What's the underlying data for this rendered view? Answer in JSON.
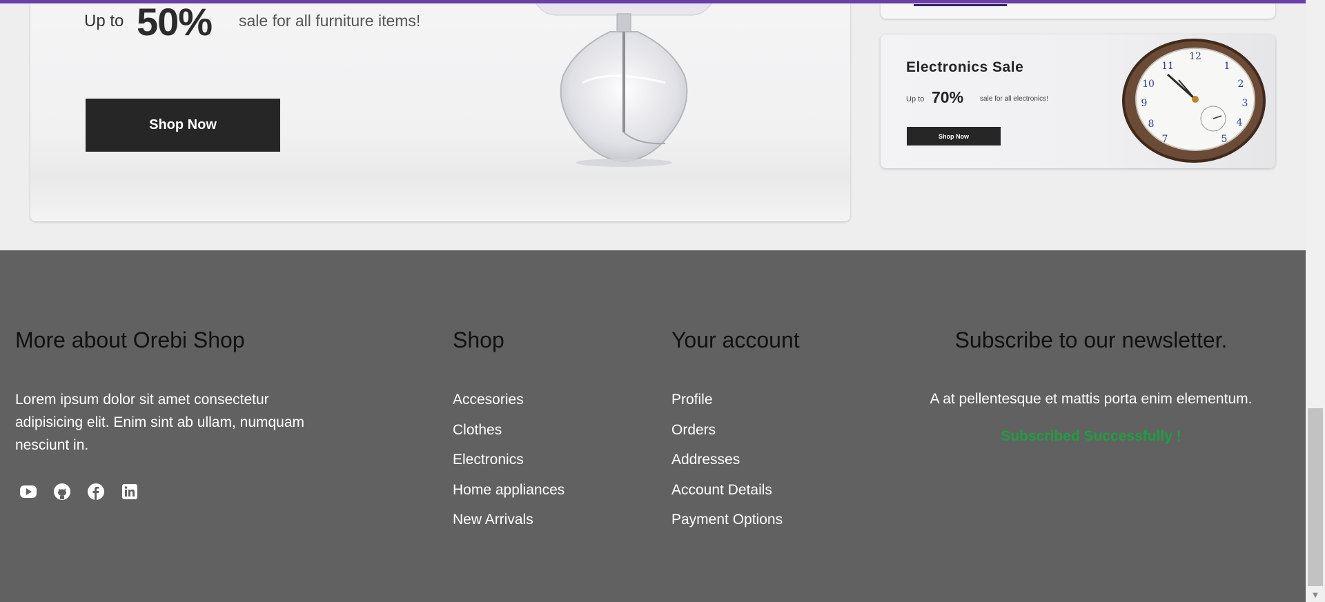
{
  "hero": {
    "up_to": "Up to",
    "percent": "50%",
    "subtitle": "sale for all furniture items!",
    "button": "Shop Now"
  },
  "side_card": {
    "title": "Electronics Sale",
    "up_to": "Up to",
    "percent": "70%",
    "subtitle": "sale for all electronics!",
    "button": "Shop Now"
  },
  "footer": {
    "about": {
      "heading": "More about Orebi Shop",
      "text_lines": [
        "Lorem ipsum dolor sit amet consectetur",
        "adipisicing elit. Enim sint ab ullam, numquam",
        "nesciunt in."
      ],
      "social_icons": [
        "youtube-icon",
        "github-icon",
        "facebook-icon",
        "linkedin-icon"
      ]
    },
    "shop": {
      "heading": "Shop",
      "links": [
        "Accesories",
        "Clothes",
        "Electronics",
        "Home appliances",
        "New Arrivals"
      ]
    },
    "account": {
      "heading": "Your account",
      "links": [
        "Profile",
        "Orders",
        "Addresses",
        "Account Details",
        "Payment Options"
      ]
    },
    "newsletter": {
      "heading": "Subscribe to our newsletter.",
      "text": "A at pellentesque et mattis porta enim elementum.",
      "status": "Subscribed Successfully !"
    }
  },
  "colors": {
    "accent": "#6b3fa8",
    "footer_bg": "#626162",
    "button_bg": "#262626",
    "success": "#1f9d3f"
  }
}
